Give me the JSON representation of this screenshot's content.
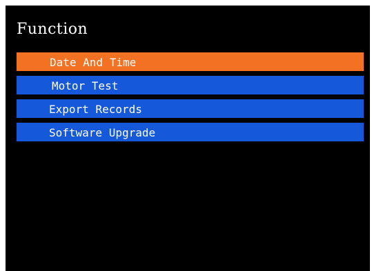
{
  "screen": {
    "title": "Function",
    "background_color": "#000000"
  },
  "menu": {
    "selected_index": 0,
    "selected_color": "#f27122",
    "item_color": "#1558d9",
    "items": [
      {
        "label": "Date And Time"
      },
      {
        "label": "Motor Test"
      },
      {
        "label": "Export Records"
      },
      {
        "label": "Software Upgrade"
      }
    ]
  }
}
